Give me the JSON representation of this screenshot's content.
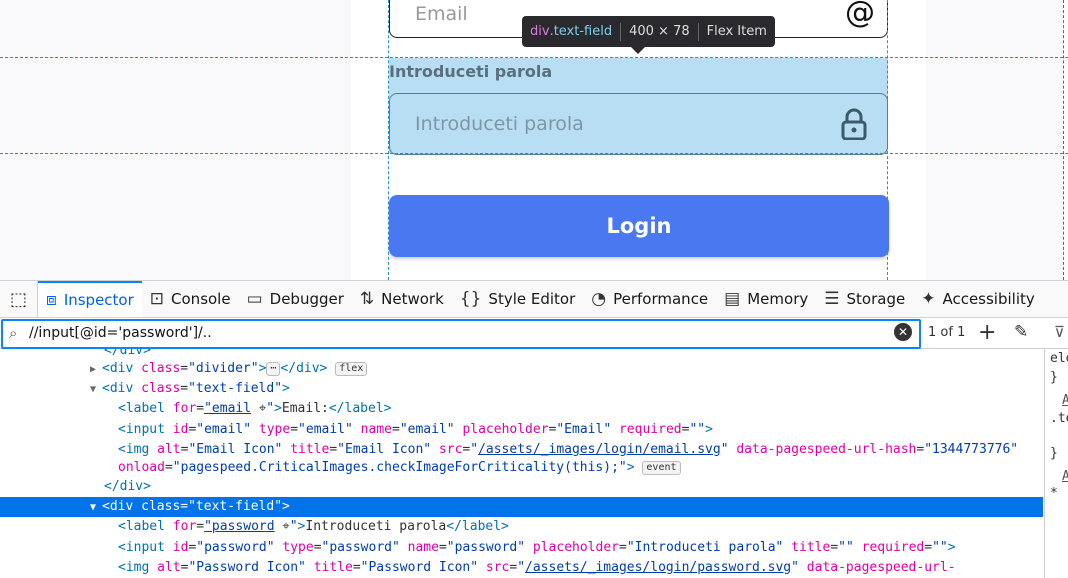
{
  "page": {
    "email_placeholder": "Email",
    "password_label": "Introduceti parola",
    "password_placeholder": "Introduceti parola",
    "login_button": "Login",
    "at_icon": "@"
  },
  "tooltip": {
    "tag": "div",
    "class": ".text-field",
    "size": "400 × 78",
    "kind": "Flex Item"
  },
  "devtools": {
    "tabs": [
      {
        "label": "Inspector",
        "icon": "inspector-icon"
      },
      {
        "label": "Console",
        "icon": "console-icon"
      },
      {
        "label": "Debugger",
        "icon": "debugger-icon"
      },
      {
        "label": "Network",
        "icon": "network-icon"
      },
      {
        "label": "Style Editor",
        "icon": "style-editor-icon"
      },
      {
        "label": "Performance",
        "icon": "performance-icon"
      },
      {
        "label": "Memory",
        "icon": "memory-icon"
      },
      {
        "label": "Storage",
        "icon": "storage-icon"
      },
      {
        "label": "Accessibility",
        "icon": "accessibility-icon"
      }
    ],
    "search": {
      "value": "//input[@id='password']/..",
      "match_count": "1 of 1"
    },
    "markup": {
      "l0": "</div>",
      "l1_tag": "div",
      "l1_attr": "class",
      "l1_val": "\"divider\"",
      "l1_badge": "flex",
      "l2_tag": "div",
      "l2_attr": "class",
      "l2_val": "\"text-field\"",
      "l3_for": "\"email",
      "l3_text": "Email:",
      "l4_id": "\"email\"",
      "l4_type": "\"email\"",
      "l4_name": "\"email\"",
      "l4_placeholder": "\"Email\"",
      "l4_required": "\"\"",
      "l5_alt": "\"Email Icon\"",
      "l5_title": "\"Email Icon\"",
      "l5_src": "/assets/_images/login/email.svg",
      "l5_hash": "\"1344773776\"",
      "l6_onload": "\"pagespeed.CriticalImages.checkImageForCriticality(this);\"",
      "l6_badge": "event",
      "l7": "</div>",
      "l8_tag": "div",
      "l8_attr": "class",
      "l8_val": "\"text-field\"",
      "l9_for": "\"password",
      "l9_text": "Introduceti parola",
      "l10_id": "\"password\"",
      "l10_type": "\"password\"",
      "l10_name": "\"password\"",
      "l10_placeholder": "\"Introduceti parola\"",
      "l10_title": "\"\"",
      "l10_required": "\"\"",
      "l11_alt": "\"Password Icon\"",
      "l11_title": "\"Password Icon\"",
      "l11_src": "/assets/_images/login/password.svg"
    },
    "sidebar": {
      "s1": "ele",
      "s2": "}",
      "s3": "A",
      "s4": ".te",
      "s5": "}",
      "s6": "A",
      "s7": "*"
    }
  }
}
